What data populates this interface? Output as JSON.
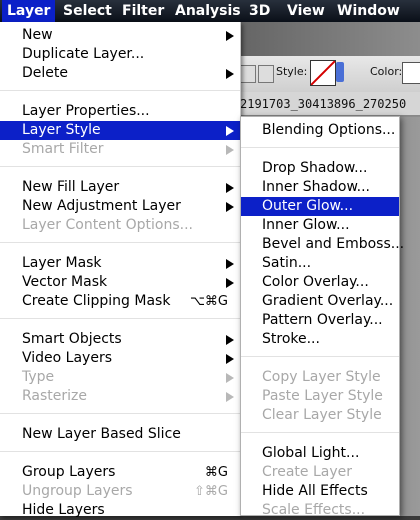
{
  "menubar": {
    "items": [
      "Layer",
      "Select",
      "Filter",
      "Analysis",
      "3D",
      "View",
      "Window"
    ]
  },
  "toolbar": {
    "style_label": "Style:",
    "color_label": "Color:",
    "doc_tab_text": "2191703_30413896_270250"
  },
  "menu": {
    "new": "New",
    "duplicate_layer": "Duplicate Layer...",
    "delete": "Delete",
    "layer_properties": "Layer Properties...",
    "layer_style": "Layer Style",
    "smart_filter": "Smart Filter",
    "new_fill_layer": "New Fill Layer",
    "new_adjustment_layer": "New Adjustment Layer",
    "layer_content_options": "Layer Content Options...",
    "layer_mask": "Layer Mask",
    "vector_mask": "Vector Mask",
    "create_clipping_mask": "Create Clipping Mask",
    "create_clipping_mask_shortcut": "⌥⌘G",
    "smart_objects": "Smart Objects",
    "video_layers": "Video Layers",
    "type": "Type",
    "rasterize": "Rasterize",
    "new_layer_based_slice": "New Layer Based Slice",
    "group_layers": "Group Layers",
    "group_layers_shortcut": "⌘G",
    "ungroup_layers": "Ungroup Layers",
    "ungroup_layers_shortcut": "⇧⌘G",
    "hide_layers": "Hide Layers"
  },
  "submenu": {
    "blending_options": "Blending Options...",
    "drop_shadow": "Drop Shadow...",
    "inner_shadow": "Inner Shadow...",
    "outer_glow": "Outer Glow...",
    "inner_glow": "Inner Glow...",
    "bevel_emboss": "Bevel and Emboss...",
    "satin": "Satin...",
    "color_overlay": "Color Overlay...",
    "gradient_overlay": "Gradient Overlay...",
    "pattern_overlay": "Pattern Overlay...",
    "stroke": "Stroke...",
    "copy_layer_style": "Copy Layer Style",
    "paste_layer_style": "Paste Layer Style",
    "clear_layer_style": "Clear Layer Style",
    "global_light": "Global Light...",
    "create_layer": "Create Layer",
    "hide_all_effects": "Hide All Effects",
    "scale_effects": "Scale Effects..."
  },
  "colors": {
    "highlight": "#0c20c8",
    "menubar": "#0a0f18",
    "disabled_text": "#a8a8a8"
  }
}
